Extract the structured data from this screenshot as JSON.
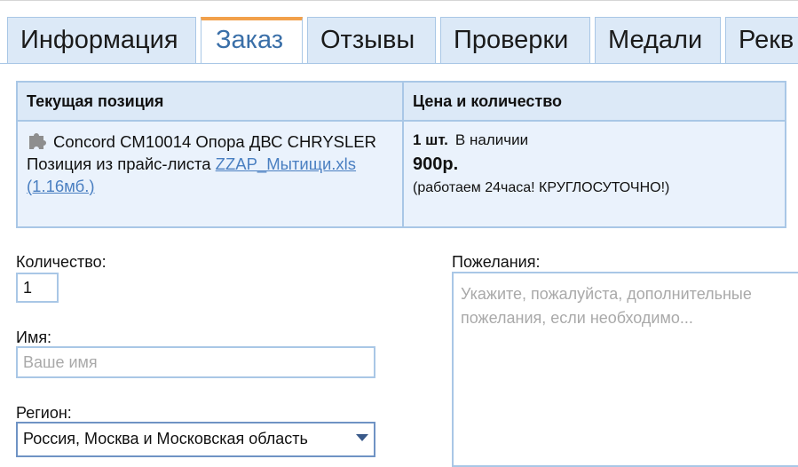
{
  "tabs": [
    {
      "label": "Информация",
      "active": false
    },
    {
      "label": "Заказ",
      "active": true
    },
    {
      "label": "Отзывы",
      "active": false
    },
    {
      "label": "Проверки",
      "active": false
    },
    {
      "label": "Медали",
      "active": false
    },
    {
      "label": "Рекв",
      "active": false
    }
  ],
  "position_table": {
    "header_item": "Текущая позиция",
    "header_price": "Цена и количество",
    "item_icon": "puzzle-piece-icon",
    "item_title": "Concord CM10014 Опора ДВС CHRYSLER",
    "pricelist_prefix": "Позиция из прайс-листа",
    "pricelist_link": "ZZAP_Мытищи.xls (1.16мб.)",
    "quantity": "1 шт.",
    "availability": "В наличии",
    "price": "900р.",
    "note": "(работаем 24часа! КРУГЛОСУТОЧНО!)"
  },
  "form": {
    "quantity_label": "Количество:",
    "quantity_value": "1",
    "name_label": "Имя:",
    "name_placeholder": "Ваше имя",
    "region_label": "Регион:",
    "region_value": "Россия, Москва и Московская область",
    "wishes_label": "Пожелания:",
    "wishes_placeholder": "Укажите, пожалуйста, дополнительные пожелания, если необходимо..."
  },
  "colors": {
    "tab_bg": "#dce9f7",
    "border": "#a9c7e6",
    "active_tab_accent": "#f2a04a",
    "active_tab_text": "#3a6fa8",
    "link": "#4a7fc1"
  }
}
